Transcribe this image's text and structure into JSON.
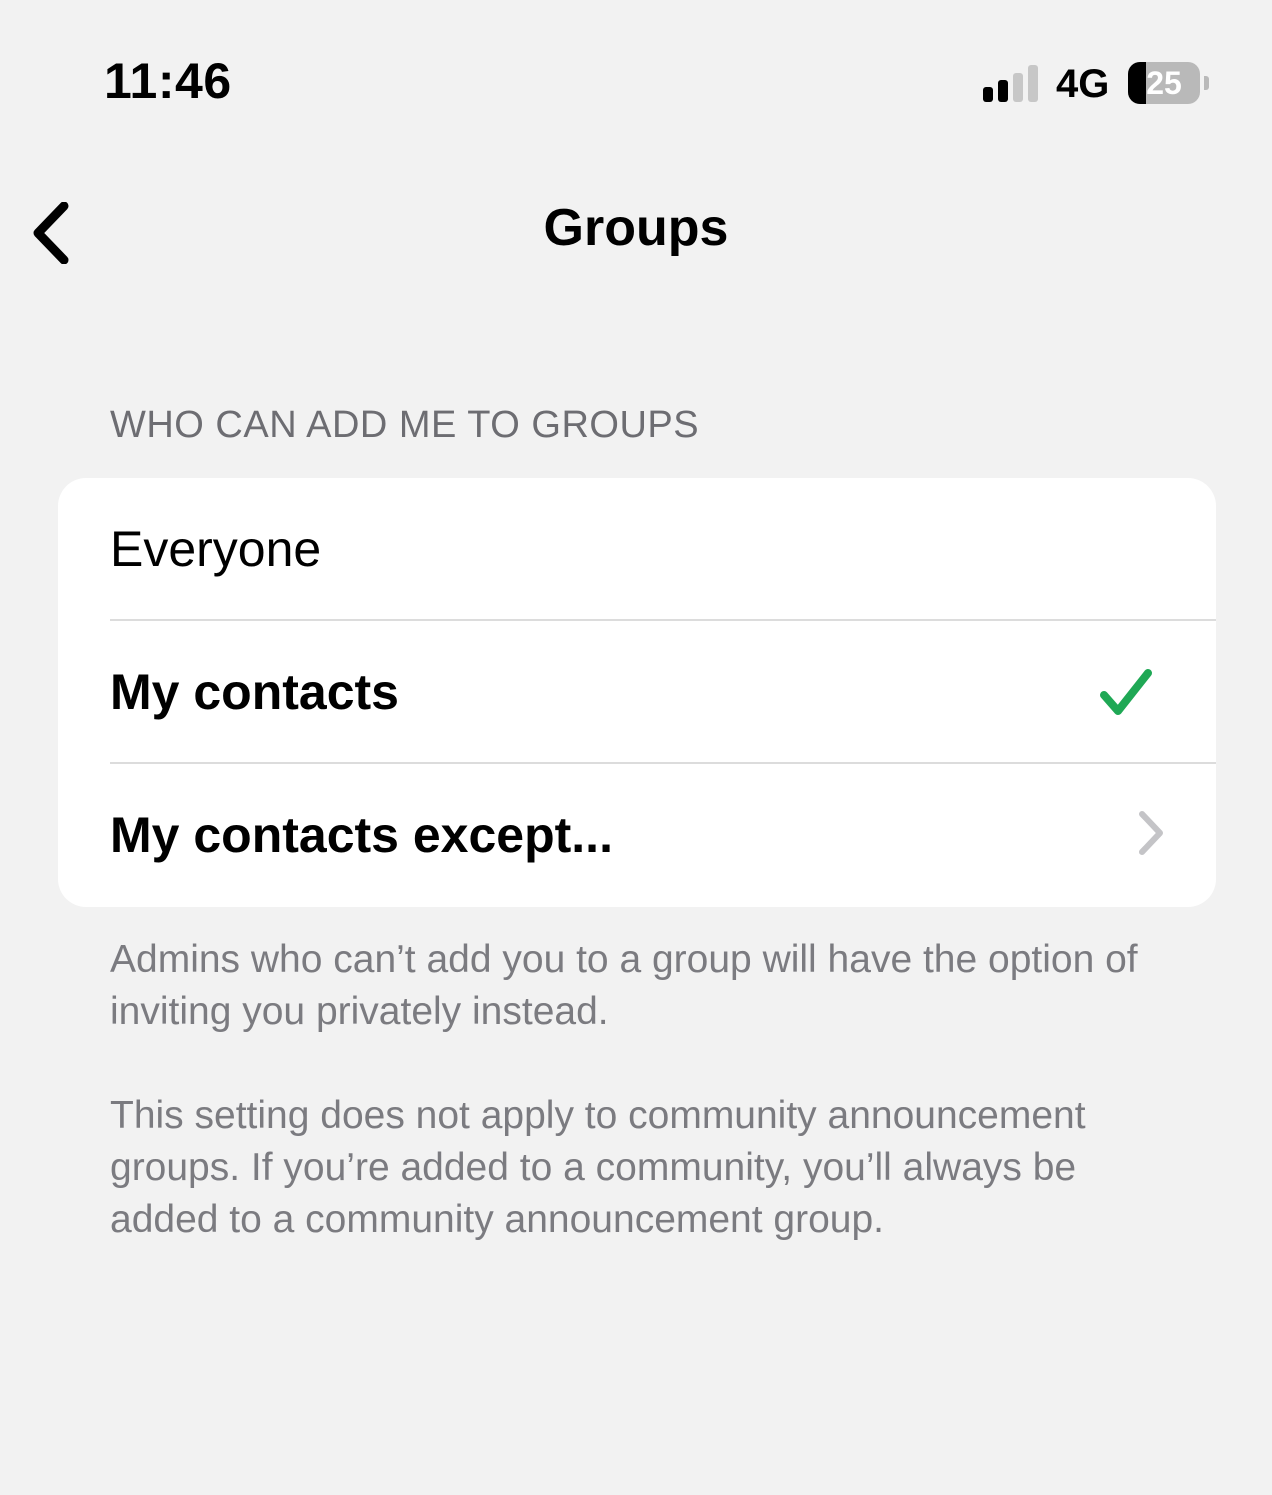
{
  "status_bar": {
    "time": "11:46",
    "network": "4G",
    "battery_level": "25",
    "battery_fraction": 0.25,
    "signal_bars_active": 2,
    "signal_bars_total": 4
  },
  "nav": {
    "title": "Groups",
    "back_icon": "chevron-left-icon"
  },
  "section": {
    "header": "WHO CAN ADD ME TO GROUPS",
    "options": [
      {
        "label": "Everyone",
        "selected": false
      },
      {
        "label": "My contacts",
        "selected": true
      },
      {
        "label": "My contacts except...",
        "selected": false,
        "has_disclosure": true
      }
    ]
  },
  "footer": {
    "note_1": "Admins who can’t add you to a group will have the option of inviting you privately instead.",
    "note_2": "This setting does not apply to community announcement groups. If you’re added to a community, you’ll always be added to a community announcement group."
  },
  "colors": {
    "background": "#f2f2f2",
    "card": "#ffffff",
    "secondary_text": "#7b7b80",
    "check_green": "#1fa855",
    "chevron_gray": "#c4c4c7"
  }
}
